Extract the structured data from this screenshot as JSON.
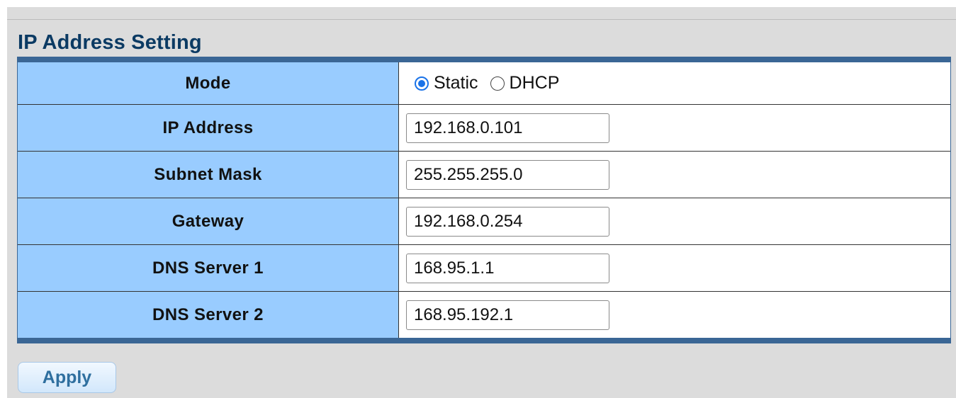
{
  "section_title": "IP Address Setting",
  "mode": {
    "label": "Mode",
    "options": [
      {
        "label": "Static",
        "checked": true
      },
      {
        "label": "DHCP",
        "checked": false
      }
    ]
  },
  "fields": {
    "ip_address": {
      "label": "IP Address",
      "value": "192.168.0.101"
    },
    "subnet_mask": {
      "label": "Subnet Mask",
      "value": "255.255.255.0"
    },
    "gateway": {
      "label": "Gateway",
      "value": "192.168.0.254"
    },
    "dns_server_1": {
      "label": "DNS Server 1",
      "value": "168.95.1.1"
    },
    "dns_server_2": {
      "label": "DNS Server 2",
      "value": "168.95.192.1"
    }
  },
  "apply_label": "Apply",
  "colors": {
    "title": "#0b3a63",
    "table_border": "#3a6695",
    "label_cell_bg": "#99ccff",
    "radio_accent": "#1a73e8",
    "apply_text": "#2f6f9f"
  }
}
